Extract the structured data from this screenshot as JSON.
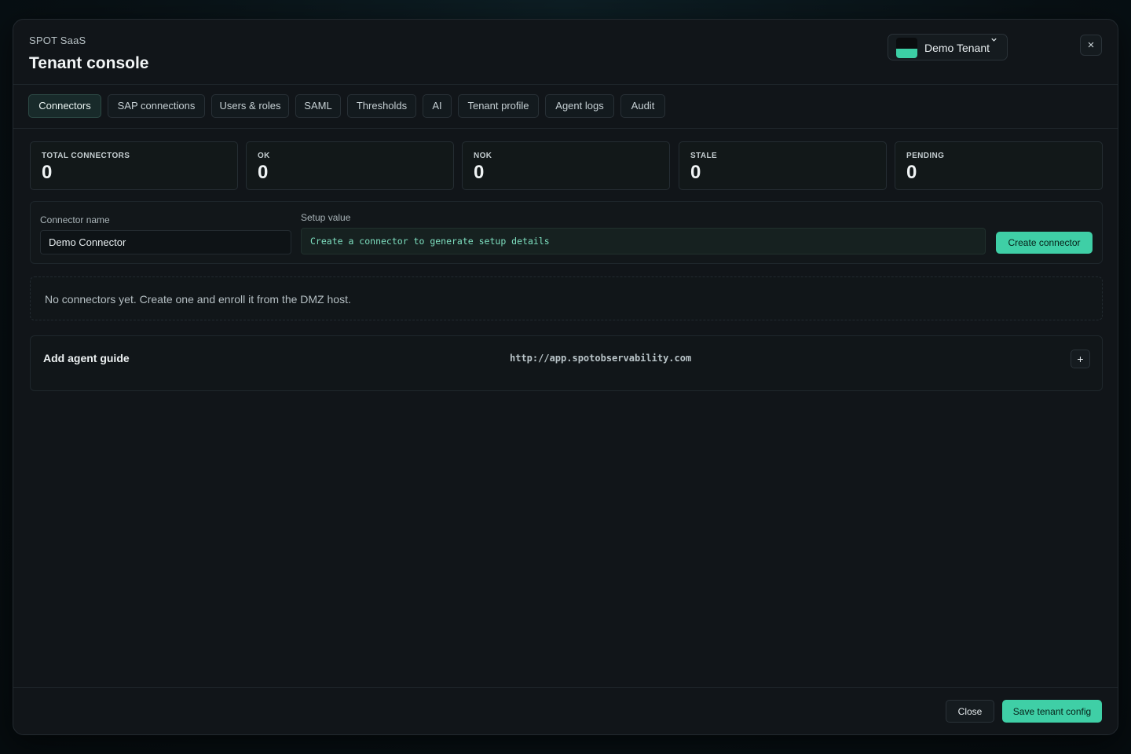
{
  "header": {
    "brand": "SPOT SaaS",
    "title": "Tenant console",
    "tenant_selector": {
      "value": "Demo Tenant",
      "icon": "chevron-down-icon"
    },
    "close_icon": "×"
  },
  "tabs": [
    {
      "label": "Connectors",
      "active": true
    },
    {
      "label": "SAP connections",
      "active": false
    },
    {
      "label": "Users & roles",
      "active": false
    },
    {
      "label": "SAML",
      "active": false
    },
    {
      "label": "Thresholds",
      "active": false
    },
    {
      "label": "AI",
      "active": false
    },
    {
      "label": "Tenant profile",
      "active": false
    },
    {
      "label": "Agent logs",
      "active": false
    },
    {
      "label": "Audit",
      "active": false
    }
  ],
  "stats": [
    {
      "label": "TOTAL CONNECTORS",
      "value": "0"
    },
    {
      "label": "OK",
      "value": "0"
    },
    {
      "label": "NOK",
      "value": "0"
    },
    {
      "label": "STALE",
      "value": "0"
    },
    {
      "label": "PENDING",
      "value": "0"
    }
  ],
  "connector_form": {
    "name_label": "Connector name",
    "name_value": "Demo Connector",
    "setup_label": "Setup value",
    "setup_value": "Create a connector to generate setup details",
    "create_button": "Create connector"
  },
  "empty_state": "No connectors yet. Create one and enroll it from the DMZ host.",
  "agent_guide": {
    "title": "Add agent guide",
    "url": "http://app.spotobservability.com",
    "expand_icon": "+"
  },
  "footer": {
    "close_button": "Close",
    "save_button": "Save tenant config"
  },
  "colors": {
    "accent": "#3fcfa6",
    "background": "#111519",
    "backdrop": "#081217"
  }
}
